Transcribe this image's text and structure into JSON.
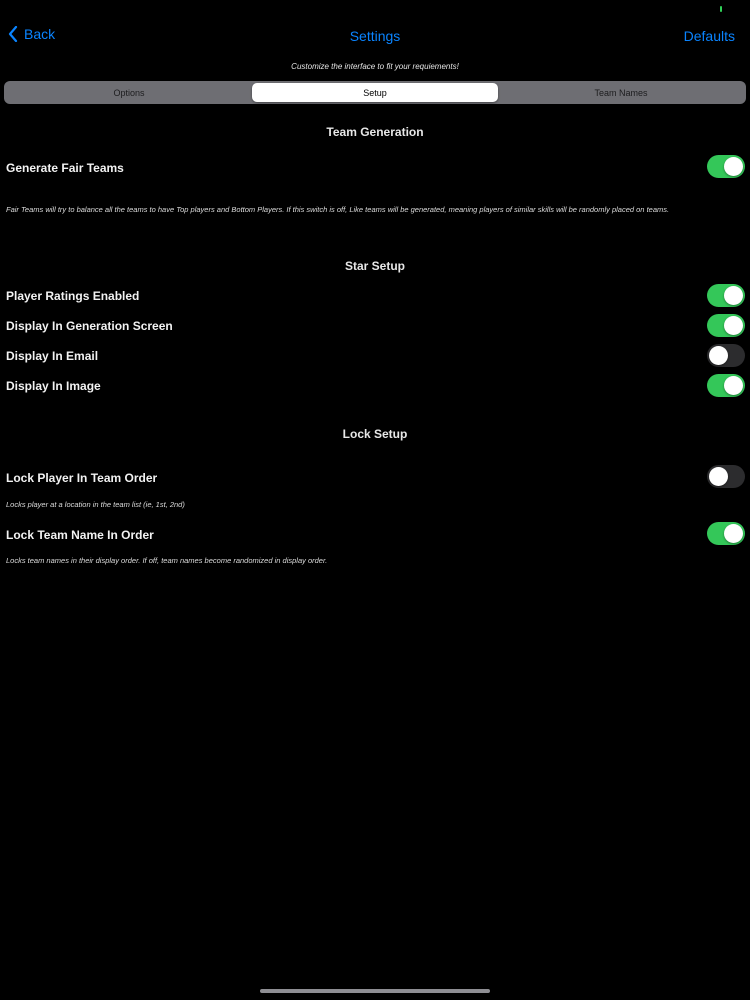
{
  "nav": {
    "back_label": "Back",
    "title": "Settings",
    "defaults_label": "Defaults"
  },
  "subtitle": "Customize the interface to fit your requiements!",
  "tabs": [
    {
      "label": "Options",
      "active": false
    },
    {
      "label": "Setup",
      "active": true
    },
    {
      "label": "Team Names",
      "active": false
    }
  ],
  "team_generation": {
    "title": "Team Generation",
    "fair_teams": {
      "label": "Generate Fair Teams",
      "on": true
    },
    "description": "Fair Teams will try to balance all the teams to have Top players and Bottom Players.   If this switch is off, Like teams will be generated, meaning players of similar skills will be randomly placed on teams."
  },
  "star_setup": {
    "title": "Star Setup",
    "items": [
      {
        "label": "Player Ratings Enabled",
        "on": true
      },
      {
        "label": "Display In Generation Screen",
        "on": true
      },
      {
        "label": "Display In Email",
        "on": false
      },
      {
        "label": "Display In Image",
        "on": true
      }
    ]
  },
  "lock_setup": {
    "title": "Lock Setup",
    "player_order": {
      "label": "Lock Player In Team Order",
      "on": false,
      "description": "Locks player at a location in the team list (ie, 1st, 2nd)"
    },
    "team_name_order": {
      "label": "Lock Team Name In Order",
      "on": true,
      "description": "Locks team names in their display order.  If off, team names become randomized in display order."
    }
  },
  "colors": {
    "accent": "#0a84ff",
    "toggle_on": "#34c759",
    "toggle_off": "#2c2c2e",
    "background": "#000000"
  }
}
